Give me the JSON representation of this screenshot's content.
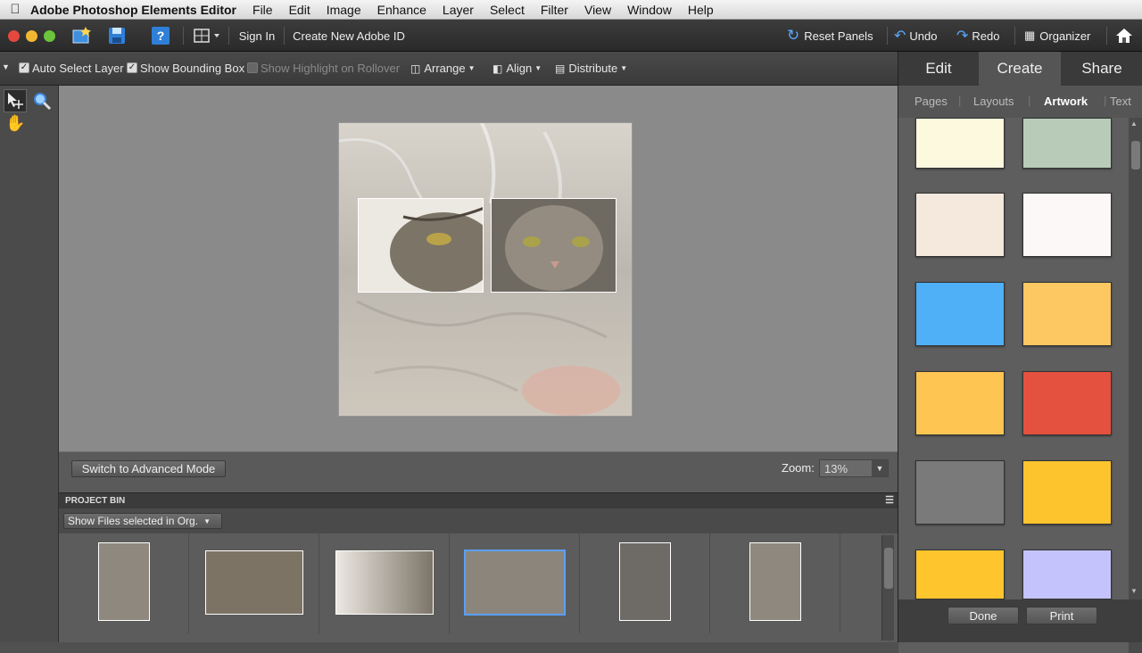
{
  "menubar": {
    "app_name": "Adobe Photoshop Elements Editor",
    "items": [
      "File",
      "Edit",
      "Image",
      "Enhance",
      "Layer",
      "Select",
      "Filter",
      "View",
      "Window",
      "Help"
    ]
  },
  "toolbar": {
    "sign_in": "Sign In",
    "create_id": "Create New Adobe ID",
    "reset_panels": "Reset Panels",
    "undo": "Undo",
    "redo": "Redo",
    "organizer": "Organizer"
  },
  "options": {
    "auto_select_layer": "Auto Select Layer",
    "show_bounding_box": "Show Bounding Box",
    "show_highlight": "Show Highlight on Rollover",
    "arrange": "Arrange",
    "align": "Align",
    "distribute": "Distribute"
  },
  "canvas": {
    "switch_mode": "Switch to Advanced Mode",
    "zoom_label": "Zoom:",
    "zoom_value": "13%"
  },
  "project_bin": {
    "title": "PROJECT BIN",
    "filter": "Show Files selected in Org."
  },
  "right_panel": {
    "tabs": [
      "Edit",
      "Create",
      "Share"
    ],
    "subtabs": [
      "Pages",
      "Layouts",
      "Artwork",
      "Text"
    ],
    "done": "Done",
    "print": "Print"
  },
  "colors": {
    "swatches": [
      "#fdf9df",
      "#b8cbb9",
      "#f4e9dc",
      "#fbf8f7",
      "#4fb0f7",
      "#fdc762",
      "#fec553",
      "#e4513f",
      "#7a7a7a",
      "#fec42e",
      "#fec52d",
      "#c4c3fb"
    ],
    "selected_outline": "#5aa0ff"
  },
  "icons": [
    "apple-icon",
    "new-file-icon",
    "save-icon",
    "help-icon",
    "layout-icon",
    "reset-icon",
    "undo-icon",
    "redo-icon",
    "organizer-icon",
    "home-icon",
    "move-tool-icon",
    "zoom-tool-icon",
    "hand-tool-icon"
  ]
}
